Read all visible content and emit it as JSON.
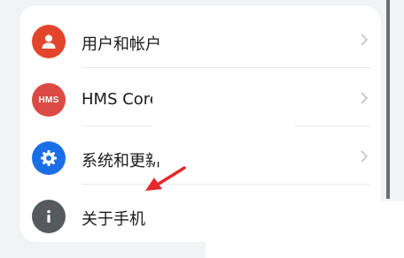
{
  "settings": {
    "items": [
      {
        "label": "用户和帐户",
        "icon": "user-icon",
        "color": "#e2452c"
      },
      {
        "label": "HMS Core",
        "icon": "hms-icon",
        "icon_text": "HMS",
        "color": "#db4a43"
      },
      {
        "label": "系统和更新",
        "icon": "gear-icon",
        "color": "#1a6fe8"
      },
      {
        "label": "关于手机",
        "icon": "info-icon",
        "color": "#555a5e"
      }
    ]
  },
  "annotation": {
    "arrow_color": "#e32929",
    "arrow_icon": "red-pointer-arrow-icon"
  }
}
